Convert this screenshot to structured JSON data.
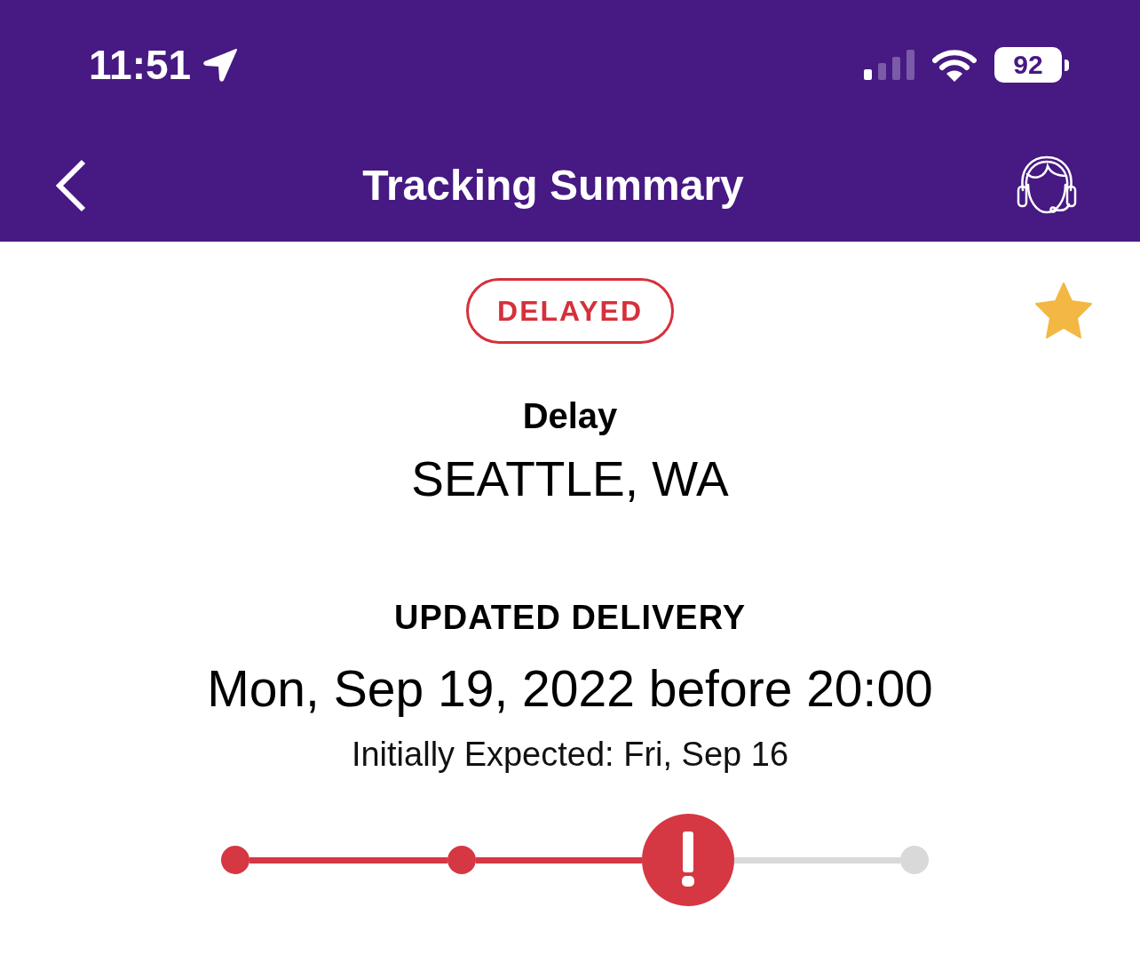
{
  "status_bar": {
    "time": "11:51",
    "battery": "92"
  },
  "nav_bar": {
    "title": "Tracking Summary"
  },
  "shipment": {
    "status_badge": "DELAYED",
    "favorite": true,
    "event_label": "Delay",
    "location": "SEATTLE, WA",
    "delivery_label": "UPDATED DELIVERY",
    "delivery_date": "Mon, Sep 19, 2022 before 20:00",
    "initially_expected": "Initially Expected: Fri, Sep 16"
  },
  "progress": {
    "steps": [
      {
        "kind": "done"
      },
      {
        "kind": "done"
      },
      {
        "kind": "alert"
      },
      {
        "kind": "pending"
      }
    ]
  }
}
